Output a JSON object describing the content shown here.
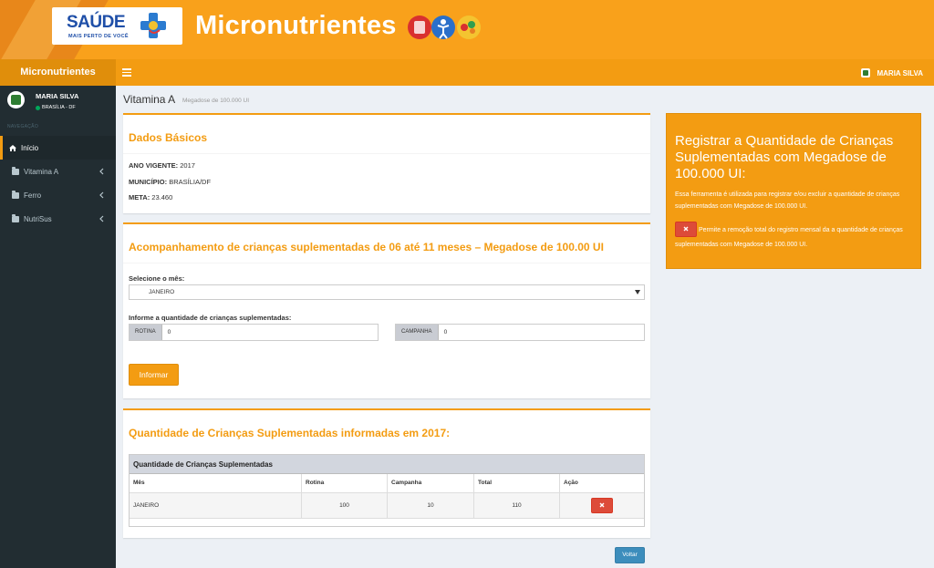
{
  "banner": {
    "logo_main": "SAÚDE",
    "logo_sub": "MAIS PERTO DE VOCÊ",
    "title": "Micronutrientes"
  },
  "topbar": {
    "brand": "Micronutrientes",
    "user": "MARIA SILVA"
  },
  "sidebar": {
    "user_name": "MARIA SILVA",
    "user_location": "BRASÍLIA - DF",
    "nav_header": "NAVEGAÇÃO",
    "items": [
      {
        "label": "Início",
        "icon": "home-icon"
      },
      {
        "label": "Vitamina A",
        "icon": "folder-icon"
      },
      {
        "label": "Ferro",
        "icon": "folder-icon"
      },
      {
        "label": "NutriSus",
        "icon": "folder-icon"
      }
    ]
  },
  "page": {
    "title": "Vitamina A",
    "subtitle": "Megadose de 100.000 UI"
  },
  "dados": {
    "title": "Dados Básicos",
    "ano_label": "ANO VIGENTE:",
    "ano_value": "2017",
    "municipio_label": "MUNICÍPIO:",
    "municipio_value": "BRASÍLIA/DF",
    "meta_label": "META:",
    "meta_value": "23.460"
  },
  "acompanhamento": {
    "title": "Acompanhamento de crianças suplementadas de 06 até 11 meses – Megadose de 100.00 UI",
    "select_label": "Selecione o mês:",
    "select_value": "JANEIRO",
    "qty_label": "Informe a quantidade de crianças suplementadas:",
    "rotina_label": "ROTINA",
    "rotina_value": "0",
    "campanha_label": "CAMPANHA",
    "campanha_value": "0",
    "submit_label": "Informar"
  },
  "quantidade": {
    "title": "Quantidade de Crianças Suplementadas informadas em 2017:",
    "table_title": "Quantidade de Crianças Suplementadas",
    "columns": [
      "Mês",
      "Rotina",
      "Campanha",
      "Total",
      "Ação"
    ],
    "rows": [
      {
        "mes": "JANEIRO",
        "rotina": "100",
        "campanha": "10",
        "total": "110"
      }
    ]
  },
  "voltar_label": "Voltar",
  "info": {
    "title": "Registrar a Quantidade de Crianças Suplementadas com Megadose de 100.000 UI:",
    "text1": "Essa ferramenta é utilizada para registrar e/ou excluir a quantidade de crianças suplementadas com Megadose de 100.000 UI.",
    "text2": "Permite a remoção total do registro mensal da a quantidade de crianças suplementadas com Megadose de 100.000 UI."
  },
  "colors": {
    "accent": "#f39c12",
    "sidebar": "#222d32",
    "danger": "#dd4b39",
    "primary": "#3c8dbc"
  }
}
